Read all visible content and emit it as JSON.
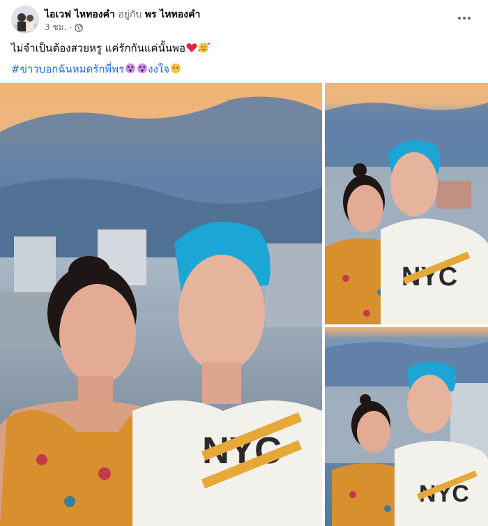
{
  "post": {
    "author": "ไอเวฟ ไหทองคำ",
    "with_text": "อยู่กับ",
    "tagged": "พร ไหทองคำ",
    "time": "3 ชม.",
    "text": "ไม่จำเป็นต้องสวยหรู แค่รักกันแค่นั้นพอ",
    "hashtag_prefix": "#ข่าวบอกฉันหมดรักพี่พร",
    "hashtag_suffix": "งงใจ",
    "icons": {
      "privacy": "globe-icon",
      "more": "more-options-icon",
      "heart": "red-heart-emoji",
      "love_face": "smiling-face-with-hearts-emoji",
      "dizzy": "dizzy-face-emoji",
      "no_mouth": "face-without-mouth-emoji"
    },
    "colors": {
      "link": "#216fdb",
      "secondary_text": "#65676b",
      "hair_blue": "#1ba6d6",
      "shirt_white": "#f3f1ec",
      "dress_orange": "#d8902e"
    }
  },
  "photos": [
    {
      "id": "main"
    },
    {
      "id": "top-right"
    },
    {
      "id": "bottom-right"
    }
  ]
}
